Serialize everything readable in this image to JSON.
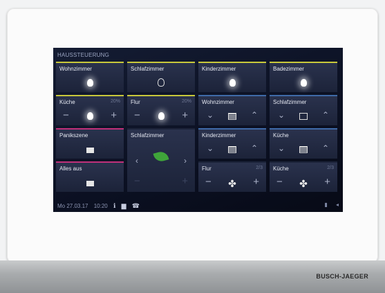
{
  "header": {
    "title": "HAUSSTEUERUNG"
  },
  "tiles": {
    "r1c1": {
      "label": "Wohnzimmer"
    },
    "r1c2": {
      "label": "Schlafzimmer"
    },
    "r1c3": {
      "label": "Kinderzimmer"
    },
    "r1c4": {
      "label": "Badezimmer"
    },
    "r2c1": {
      "label": "Küche",
      "value": "20%",
      "minus": "−",
      "plus": "+"
    },
    "r2c2": {
      "label": "Flur",
      "value": "20%",
      "minus": "−",
      "plus": "+"
    },
    "r2c3": {
      "label": "Wohnzimmer"
    },
    "r2c4": {
      "label": "Schlafzimmer"
    },
    "r3c1": {
      "label": "Panikszene"
    },
    "r3c2": {
      "label": "Schlafzimmer"
    },
    "r3c3": {
      "label": "Kinderzimmer"
    },
    "r3c4": {
      "label": "Küche"
    },
    "r4c1": {
      "label": "Alles aus"
    },
    "r4c3": {
      "label": "Flur",
      "value": "2/3",
      "minus": "−",
      "plus": "+"
    },
    "r4c4": {
      "label": "Küche",
      "value": "2/3",
      "minus": "−",
      "plus": "+"
    }
  },
  "status": {
    "date": "Mo 27.03.17",
    "time": "10:20"
  },
  "brand": "BUSCH-JAEGER",
  "colors": {
    "yellow": "#c8c83a",
    "blue": "#3f6aa8",
    "magenta": "#c0307a",
    "screen_bg": "#0b1022"
  }
}
